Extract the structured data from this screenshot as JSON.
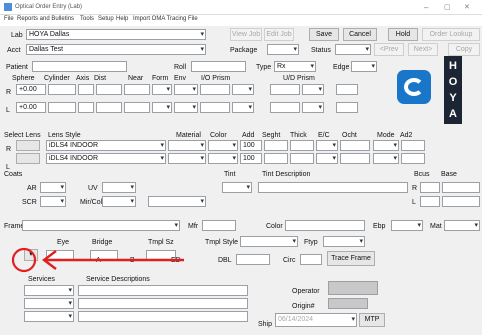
{
  "window": {
    "title": "Optical Order Entry (Lab)",
    "minimize": "–",
    "maximize": "▢",
    "close": "✕"
  },
  "menu": [
    "File",
    "Reports and Bulletins",
    "Tools",
    "Setup",
    "Help",
    "Import OMA Tracing File"
  ],
  "header": {
    "lab_label": "Lab",
    "lab_value": "HOYA Dallas",
    "acct_label": "Acct",
    "acct_value": "Dallas Test",
    "package_label": "Package",
    "status_label": "Status",
    "buttons": {
      "view_job": "View Job",
      "edit_job": "Edit Job",
      "save": "Save",
      "cancel": "Cancel",
      "hold": "Hold",
      "order_lookup": "Order Lookup",
      "prev": "<Prev",
      "next": "Next>",
      "copy": "Copy"
    }
  },
  "rx": {
    "patient_label": "Patient",
    "roll_label": "Roll",
    "type_label": "Type",
    "type_value": "Rx",
    "edge_label": "Edge",
    "columns": [
      "Sphere",
      "Cylinder",
      "Axis",
      "Dist",
      "Near",
      "Form",
      "Env",
      "I/O Prism",
      "U/D Prism"
    ],
    "r_label": "R",
    "l_label": "L",
    "r_sphere": "+0.00",
    "l_sphere": "+0.00"
  },
  "lens": {
    "select_lens_label": "Select Lens",
    "lens_style_label": "Lens Style",
    "material_label": "Material",
    "color_label": "Color",
    "add_label": "Add",
    "seght_label": "Seght",
    "thick_label": "Thick",
    "ec_label": "E/C",
    "ocht_label": "Ocht",
    "mode_label": "Mode",
    "ad2_label": "Ad2",
    "r_style": "iDLS4 INDOOR",
    "l_style": "iDLS4 INDOOR",
    "r_add": "100",
    "l_add": "100"
  },
  "coats": {
    "coats_label": "Coats",
    "tint_label": "Tint",
    "tint_desc_label": "Tint Description",
    "bcus_label": "Bcus",
    "base_label": "Base",
    "ar_label": "AR",
    "uv_label": "UV",
    "scr_label": "SCR",
    "mirror_label": "Mir/Col",
    "r_label": "R",
    "l_label": "L"
  },
  "frame": {
    "frame_label": "Frame",
    "mfr_label": "Mfr",
    "color_label": "Color",
    "ebp_label": "Ebp",
    "mat_label": "Mat",
    "eye_label": "Eye",
    "bridge_label": "Bridge",
    "tmpl_sz_label": "Tmpl Sz",
    "tmpl_style_label": "Tmpl Style",
    "ftyp_label": "Ftyp",
    "a_label": "A",
    "b_label": "B",
    "ed_label": "ED",
    "dbl_label": "DBL",
    "circ_label": "Circ",
    "trace_frame": "Trace Frame"
  },
  "services": {
    "services_label": "Services",
    "desc_label": "Service Descriptions",
    "operator_label": "Operator",
    "origin_label": "Origin#",
    "ship_label": "Ship",
    "ship_date": "06/14/2024",
    "mtp": "MTP"
  },
  "logo": {
    "brand": "HOYA"
  },
  "colors": {
    "annotation": "#e02020",
    "logo_blue": "#1976c8",
    "logo_dark": "#1c2533"
  }
}
